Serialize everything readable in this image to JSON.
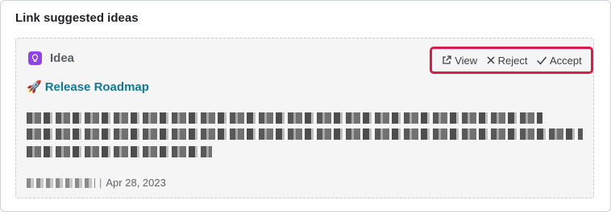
{
  "panel": {
    "title": "Link suggested ideas"
  },
  "card": {
    "type_label": "Idea",
    "title_emoji": "🚀",
    "title": "Release Roadmap",
    "actions": {
      "view": "View",
      "reject": "Reject",
      "accept": "Accept"
    },
    "meta": {
      "separator": "|",
      "date": "Apr 28, 2023"
    }
  },
  "colors": {
    "highlight_border": "#d81b4a",
    "idea_icon": "#8e44e8",
    "title_link": "#127a95"
  }
}
